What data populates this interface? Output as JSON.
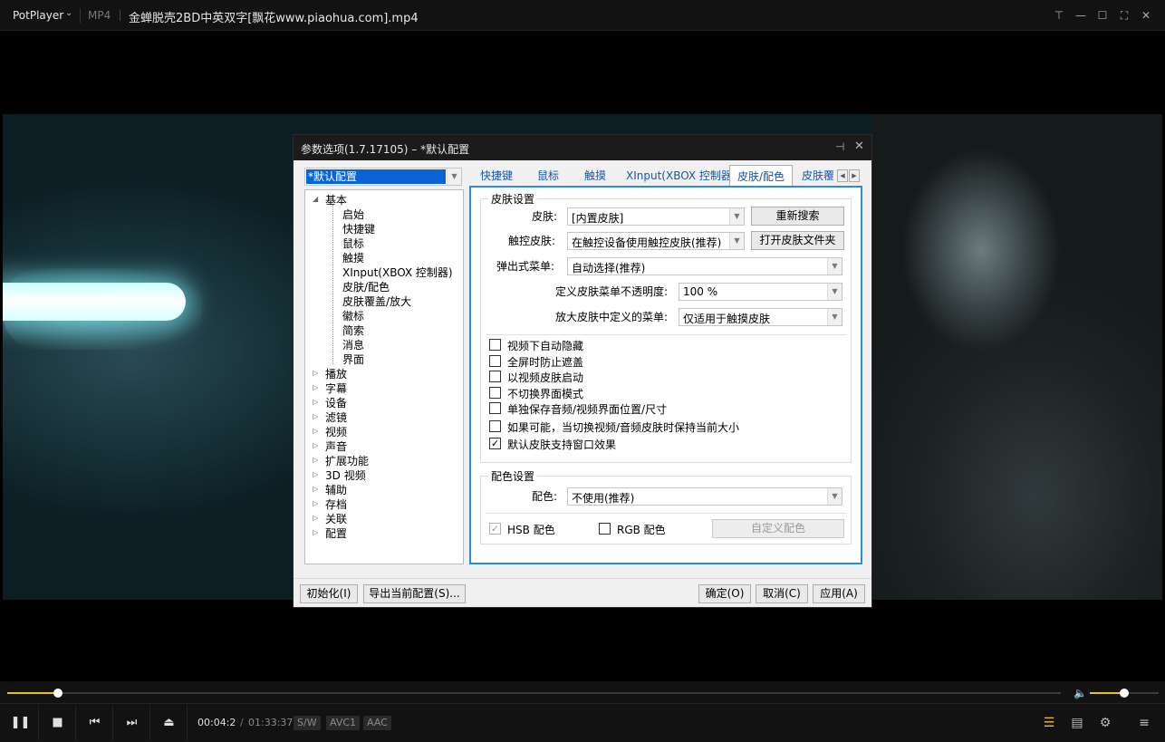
{
  "titlebar": {
    "brand": "PotPlayer",
    "format": "MP4",
    "file_title": "金蝉脱壳2BD中英双字[飘花www.piaohua.com].mp4",
    "buttons": {
      "pin": "⊤",
      "minimize": "—",
      "maximize": "☐",
      "fullscreen": "⛶",
      "close": "✕"
    }
  },
  "dialog": {
    "title": "参数选项(1.7.17105) – *默认配置",
    "profile": "*默认配置",
    "tree": [
      {
        "label": "基本",
        "level": 0,
        "expanded": true
      },
      {
        "label": "启始",
        "level": 1
      },
      {
        "label": "快捷键",
        "level": 1
      },
      {
        "label": "鼠标",
        "level": 1
      },
      {
        "label": "触摸",
        "level": 1
      },
      {
        "label": "XInput(XBOX 控制器)",
        "level": 1
      },
      {
        "label": "皮肤/配色",
        "level": 1
      },
      {
        "label": "皮肤覆盖/放大",
        "level": 1
      },
      {
        "label": "徽标",
        "level": 1
      },
      {
        "label": "简索",
        "level": 1
      },
      {
        "label": "消息",
        "level": 1
      },
      {
        "label": "界面",
        "level": 1
      },
      {
        "label": "播放",
        "level": 0
      },
      {
        "label": "字幕",
        "level": 0
      },
      {
        "label": "设备",
        "level": 0
      },
      {
        "label": "滤镜",
        "level": 0
      },
      {
        "label": "视频",
        "level": 0
      },
      {
        "label": "声音",
        "level": 0
      },
      {
        "label": "扩展功能",
        "level": 0
      },
      {
        "label": "3D 视频",
        "level": 0
      },
      {
        "label": "辅助",
        "level": 0
      },
      {
        "label": "存档",
        "level": 0
      },
      {
        "label": "关联",
        "level": 0
      },
      {
        "label": "配置",
        "level": 0
      }
    ],
    "tabs": [
      "快捷键",
      "鼠标",
      "触摸",
      "XInput(XBOX 控制器)",
      "皮肤/配色",
      "皮肤覆"
    ],
    "active_tab": "皮肤/配色",
    "skin_group": {
      "title": "皮肤设置",
      "skin_label": "皮肤:",
      "skin_value": "[内置皮肤]",
      "research_button": "重新搜索",
      "touch_skin_label": "触控皮肤:",
      "touch_skin_value": "在触控设备使用触控皮肤(推荐)",
      "open_folder_button": "打开皮肤文件夹",
      "popup_menu_label": "弹出式菜单:",
      "popup_menu_value": "自动选择(推荐)",
      "opacity_label": "定义皮肤菜单不透明度:",
      "opacity_value": "100 %",
      "zoom_menu_label": "放大皮肤中定义的菜单:",
      "zoom_menu_value": "仅适用于触摸皮肤",
      "checkboxes": [
        {
          "label": "视频下自动隐藏",
          "checked": false
        },
        {
          "label": "全屏时防止遮盖",
          "checked": false
        },
        {
          "label": "以视频皮肤启动",
          "checked": false
        },
        {
          "label": "不切换界面模式",
          "checked": false
        },
        {
          "label": "单独保存音频/视频界面位置/尺寸",
          "checked": false
        },
        {
          "label": "如果可能，当切换视频/音频皮肤时保持当前大小",
          "checked": false
        },
        {
          "label": "默认皮肤支持窗口效果",
          "checked": true
        }
      ]
    },
    "color_group": {
      "title": "配色设置",
      "color_label": "配色:",
      "color_value": "不使用(推荐)",
      "hsb_label": "HSB 配色",
      "hsb_checked": true,
      "rgb_label": "RGB 配色",
      "rgb_checked": false,
      "custom_button": "自定义配色"
    },
    "footer": {
      "reset": "初始化(I)",
      "export": "导出当前配置(S)...",
      "ok": "确定(O)",
      "cancel": "取消(C)",
      "apply": "应用(A)"
    }
  },
  "player": {
    "current_time": "00:04:29",
    "separator": "/",
    "total_time": "01:33:37",
    "progress": 0.048,
    "volume": 0.5,
    "badges": [
      "S/W",
      "AVC1",
      "AAC"
    ]
  },
  "colors": {
    "accent": "#e5c320",
    "panel_border": "#2a8ce0",
    "selection": "#0a64d8"
  }
}
